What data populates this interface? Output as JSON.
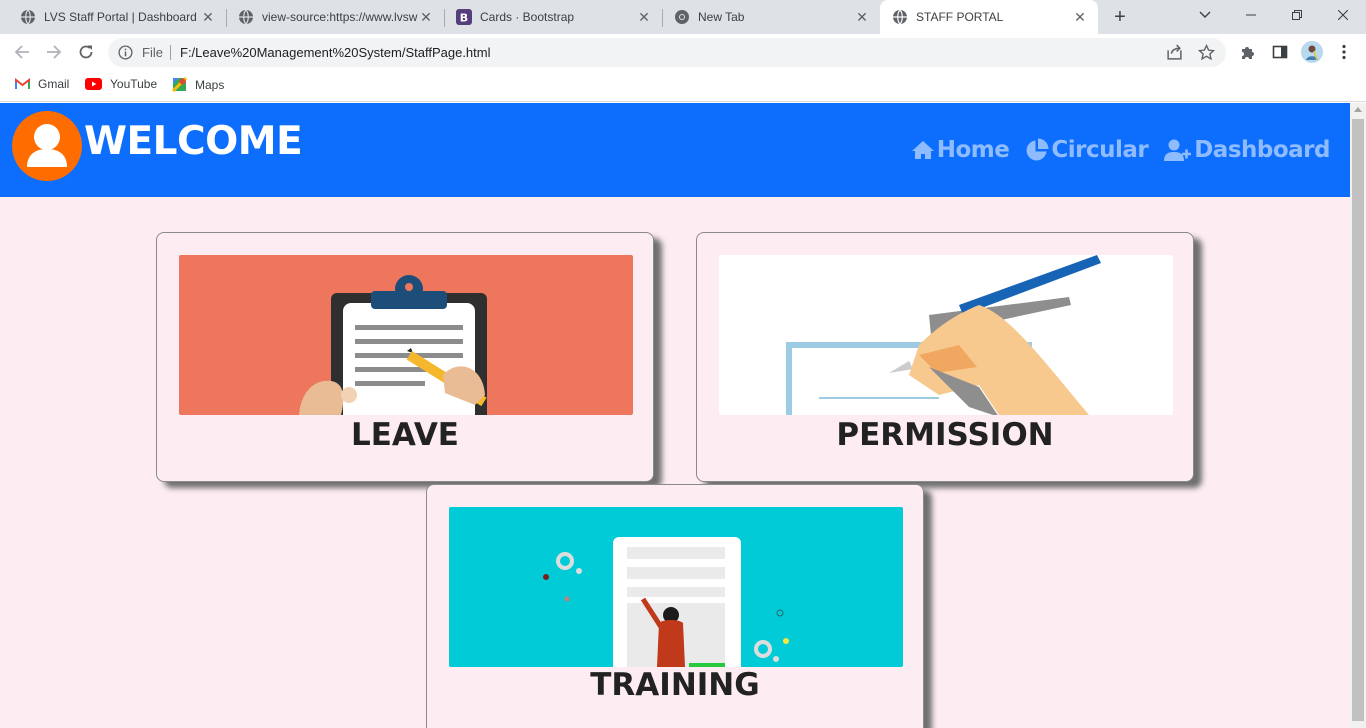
{
  "browser": {
    "tabs": [
      {
        "title": "LVS Staff Portal | Dashboard",
        "icon": "globe-icon"
      },
      {
        "title": "view-source:https://www.lvsw",
        "icon": "globe-icon"
      },
      {
        "title": "Cards · Bootstrap",
        "icon": "bootstrap-icon"
      },
      {
        "title": "New Tab",
        "icon": "chrome-icon"
      },
      {
        "title": "STAFF PORTAL",
        "icon": "globe-icon"
      }
    ],
    "active_tab": 4,
    "address": {
      "scheme_label": "File",
      "url": "F:/Leave%20Management%20System/StaffPage.html"
    },
    "bookmarks": [
      {
        "label": "Gmail",
        "icon": "gmail-icon"
      },
      {
        "label": "YouTube",
        "icon": "youtube-icon"
      },
      {
        "label": "Maps",
        "icon": "maps-icon"
      }
    ]
  },
  "page": {
    "brand": "WELCOME",
    "nav": [
      {
        "label": "Home",
        "icon": "home-icon"
      },
      {
        "label": "Circular",
        "icon": "pie-chart-icon"
      },
      {
        "label": "Dashboard",
        "icon": "user-plus-icon"
      }
    ],
    "cards": [
      {
        "title": "LEAVE",
        "image": "clipboard-illustration"
      },
      {
        "title": "PERMISSION",
        "image": "writing-hand-illustration"
      },
      {
        "title": "TRAINING",
        "image": "presentation-illustration"
      }
    ],
    "colors": {
      "navbar": "#0d6efd",
      "nav_link": "#8ebcff",
      "avatar": "#ff6c00",
      "page_bg": "#fdedf2",
      "leave_bg": "#ee765d",
      "training_bg": "#00cbd6"
    }
  }
}
